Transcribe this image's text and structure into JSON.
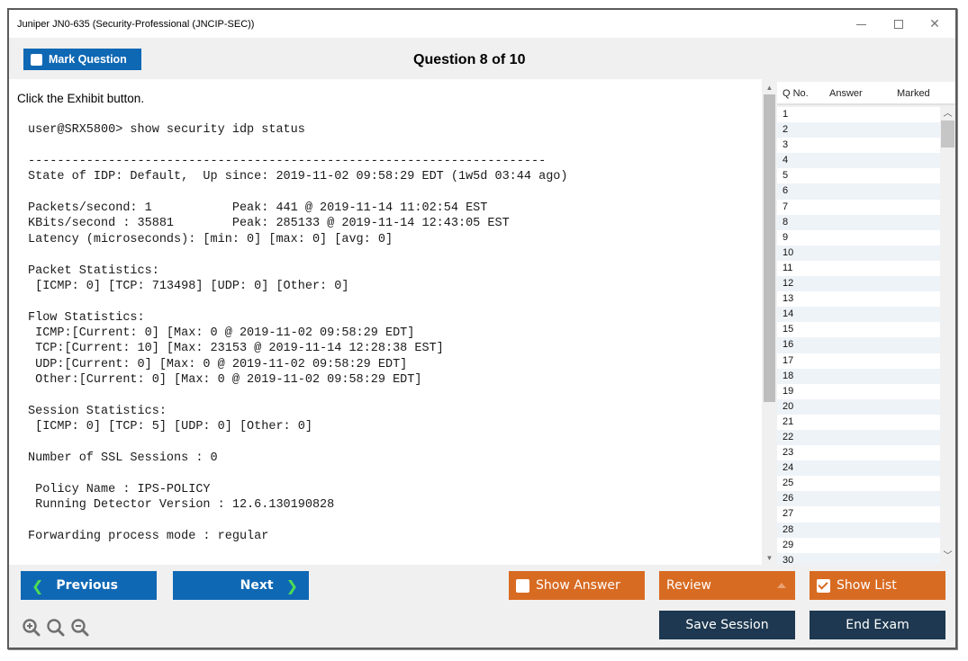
{
  "window": {
    "title": "Juniper JN0-635 (Security-Professional (JNCIP-SEC))",
    "controls": {
      "minimize": "minimize",
      "maximize": "maximize",
      "close": "close"
    }
  },
  "toolbar": {
    "mark_question_label": "Mark Question",
    "question_header": "Question 8 of 10"
  },
  "question": {
    "instruction": "Click the Exhibit button.",
    "exhibit_lines": [
      "user@SRX5800> show security idp status",
      "",
      "-----------------------------------------------------------------------",
      "State of IDP: Default,  Up since: 2019-11-02 09:58:29 EDT (1w5d 03:44 ago)",
      "",
      "Packets/second: 1           Peak: 441 @ 2019-11-14 11:02:54 EST",
      "KBits/second : 35881        Peak: 285133 @ 2019-11-14 12:43:05 EST",
      "Latency (microseconds): [min: 0] [max: 0] [avg: 0]",
      "",
      "Packet Statistics:",
      " [ICMP: 0] [TCP: 713498] [UDP: 0] [Other: 0]",
      "",
      "Flow Statistics:",
      " ICMP:[Current: 0] [Max: 0 @ 2019-11-02 09:58:29 EDT]",
      " TCP:[Current: 10] [Max: 23153 @ 2019-11-14 12:28:38 EST]",
      " UDP:[Current: 0] [Max: 0 @ 2019-11-02 09:58:29 EDT]",
      " Other:[Current: 0] [Max: 0 @ 2019-11-02 09:58:29 EDT]",
      "",
      "Session Statistics:",
      " [ICMP: 0] [TCP: 5] [UDP: 0] [Other: 0]",
      "",
      "Number of SSL Sessions : 0",
      "",
      " Policy Name : IPS-POLICY",
      " Running Detector Version : 12.6.130190828",
      "",
      "Forwarding process mode : regular"
    ]
  },
  "question_list": {
    "headers": {
      "qno": "Q No.",
      "answer": "Answer",
      "marked": "Marked"
    },
    "rows": [
      "1",
      "2",
      "3",
      "4",
      "5",
      "6",
      "7",
      "8",
      "9",
      "10",
      "11",
      "12",
      "13",
      "14",
      "15",
      "16",
      "17",
      "18",
      "19",
      "20",
      "21",
      "22",
      "23",
      "24",
      "25",
      "26",
      "27",
      "28",
      "29",
      "30"
    ]
  },
  "footer": {
    "previous_label": "Previous",
    "next_label": "Next",
    "show_answer_label": "Show Answer",
    "show_answer_checked": false,
    "review_label": "Review",
    "show_list_label": "Show List",
    "show_list_checked": true,
    "save_session_label": "Save Session",
    "end_exam_label": "End Exam"
  },
  "colors": {
    "primary_blue": "#0f68b4",
    "accent_orange": "#d86b22",
    "dark_navy": "#1d3850",
    "chevron_green": "#4ddc55"
  }
}
